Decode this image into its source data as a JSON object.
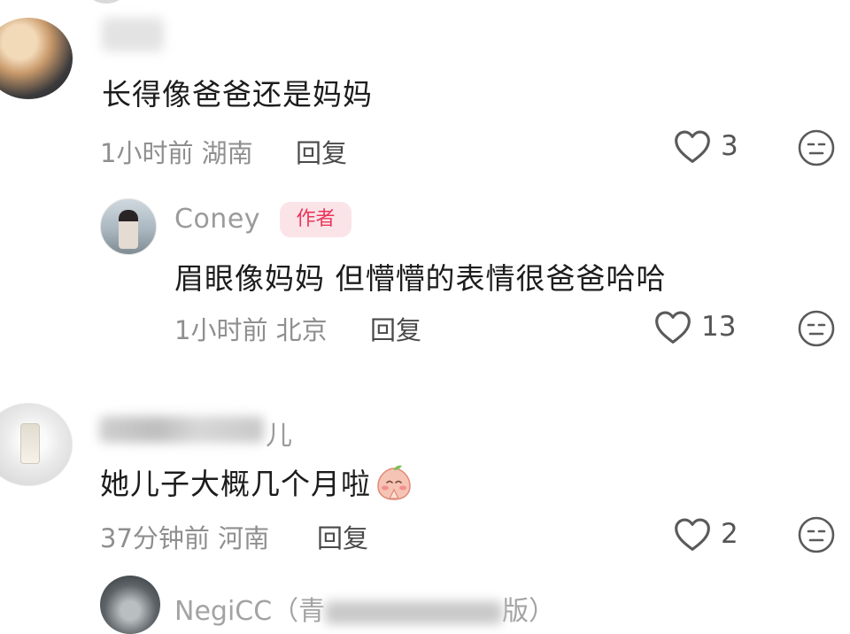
{
  "comments": [
    {
      "username": "",
      "text": "长得像爸爸还是妈妈",
      "meta": "1小时前 湖南",
      "reply_label": "回复",
      "likes": "3"
    },
    {
      "username": "Coney",
      "badge": "作者",
      "text": "眉眼像妈妈 但懵懵的表情很爸爸哈哈",
      "meta": "1小时前 北京",
      "reply_label": "回复",
      "likes": "13"
    },
    {
      "username_visible_tail": "儿",
      "text": "她儿子大概几个月啦",
      "emoji": "peach-praying-emoji",
      "meta": "37分钟前 河南",
      "reply_label": "回复",
      "likes": "2"
    },
    {
      "username_visible": "NegiCC（青",
      "username_visible_tail": "版）"
    }
  ],
  "icons": {
    "like": "heart-outline-icon",
    "dislike": "neutral-face-icon"
  },
  "colors": {
    "badge_bg": "#fbe4e8",
    "badge_text": "#e8365c",
    "meta_text": "#8f8f8f",
    "body_text": "#1c1c1c"
  }
}
